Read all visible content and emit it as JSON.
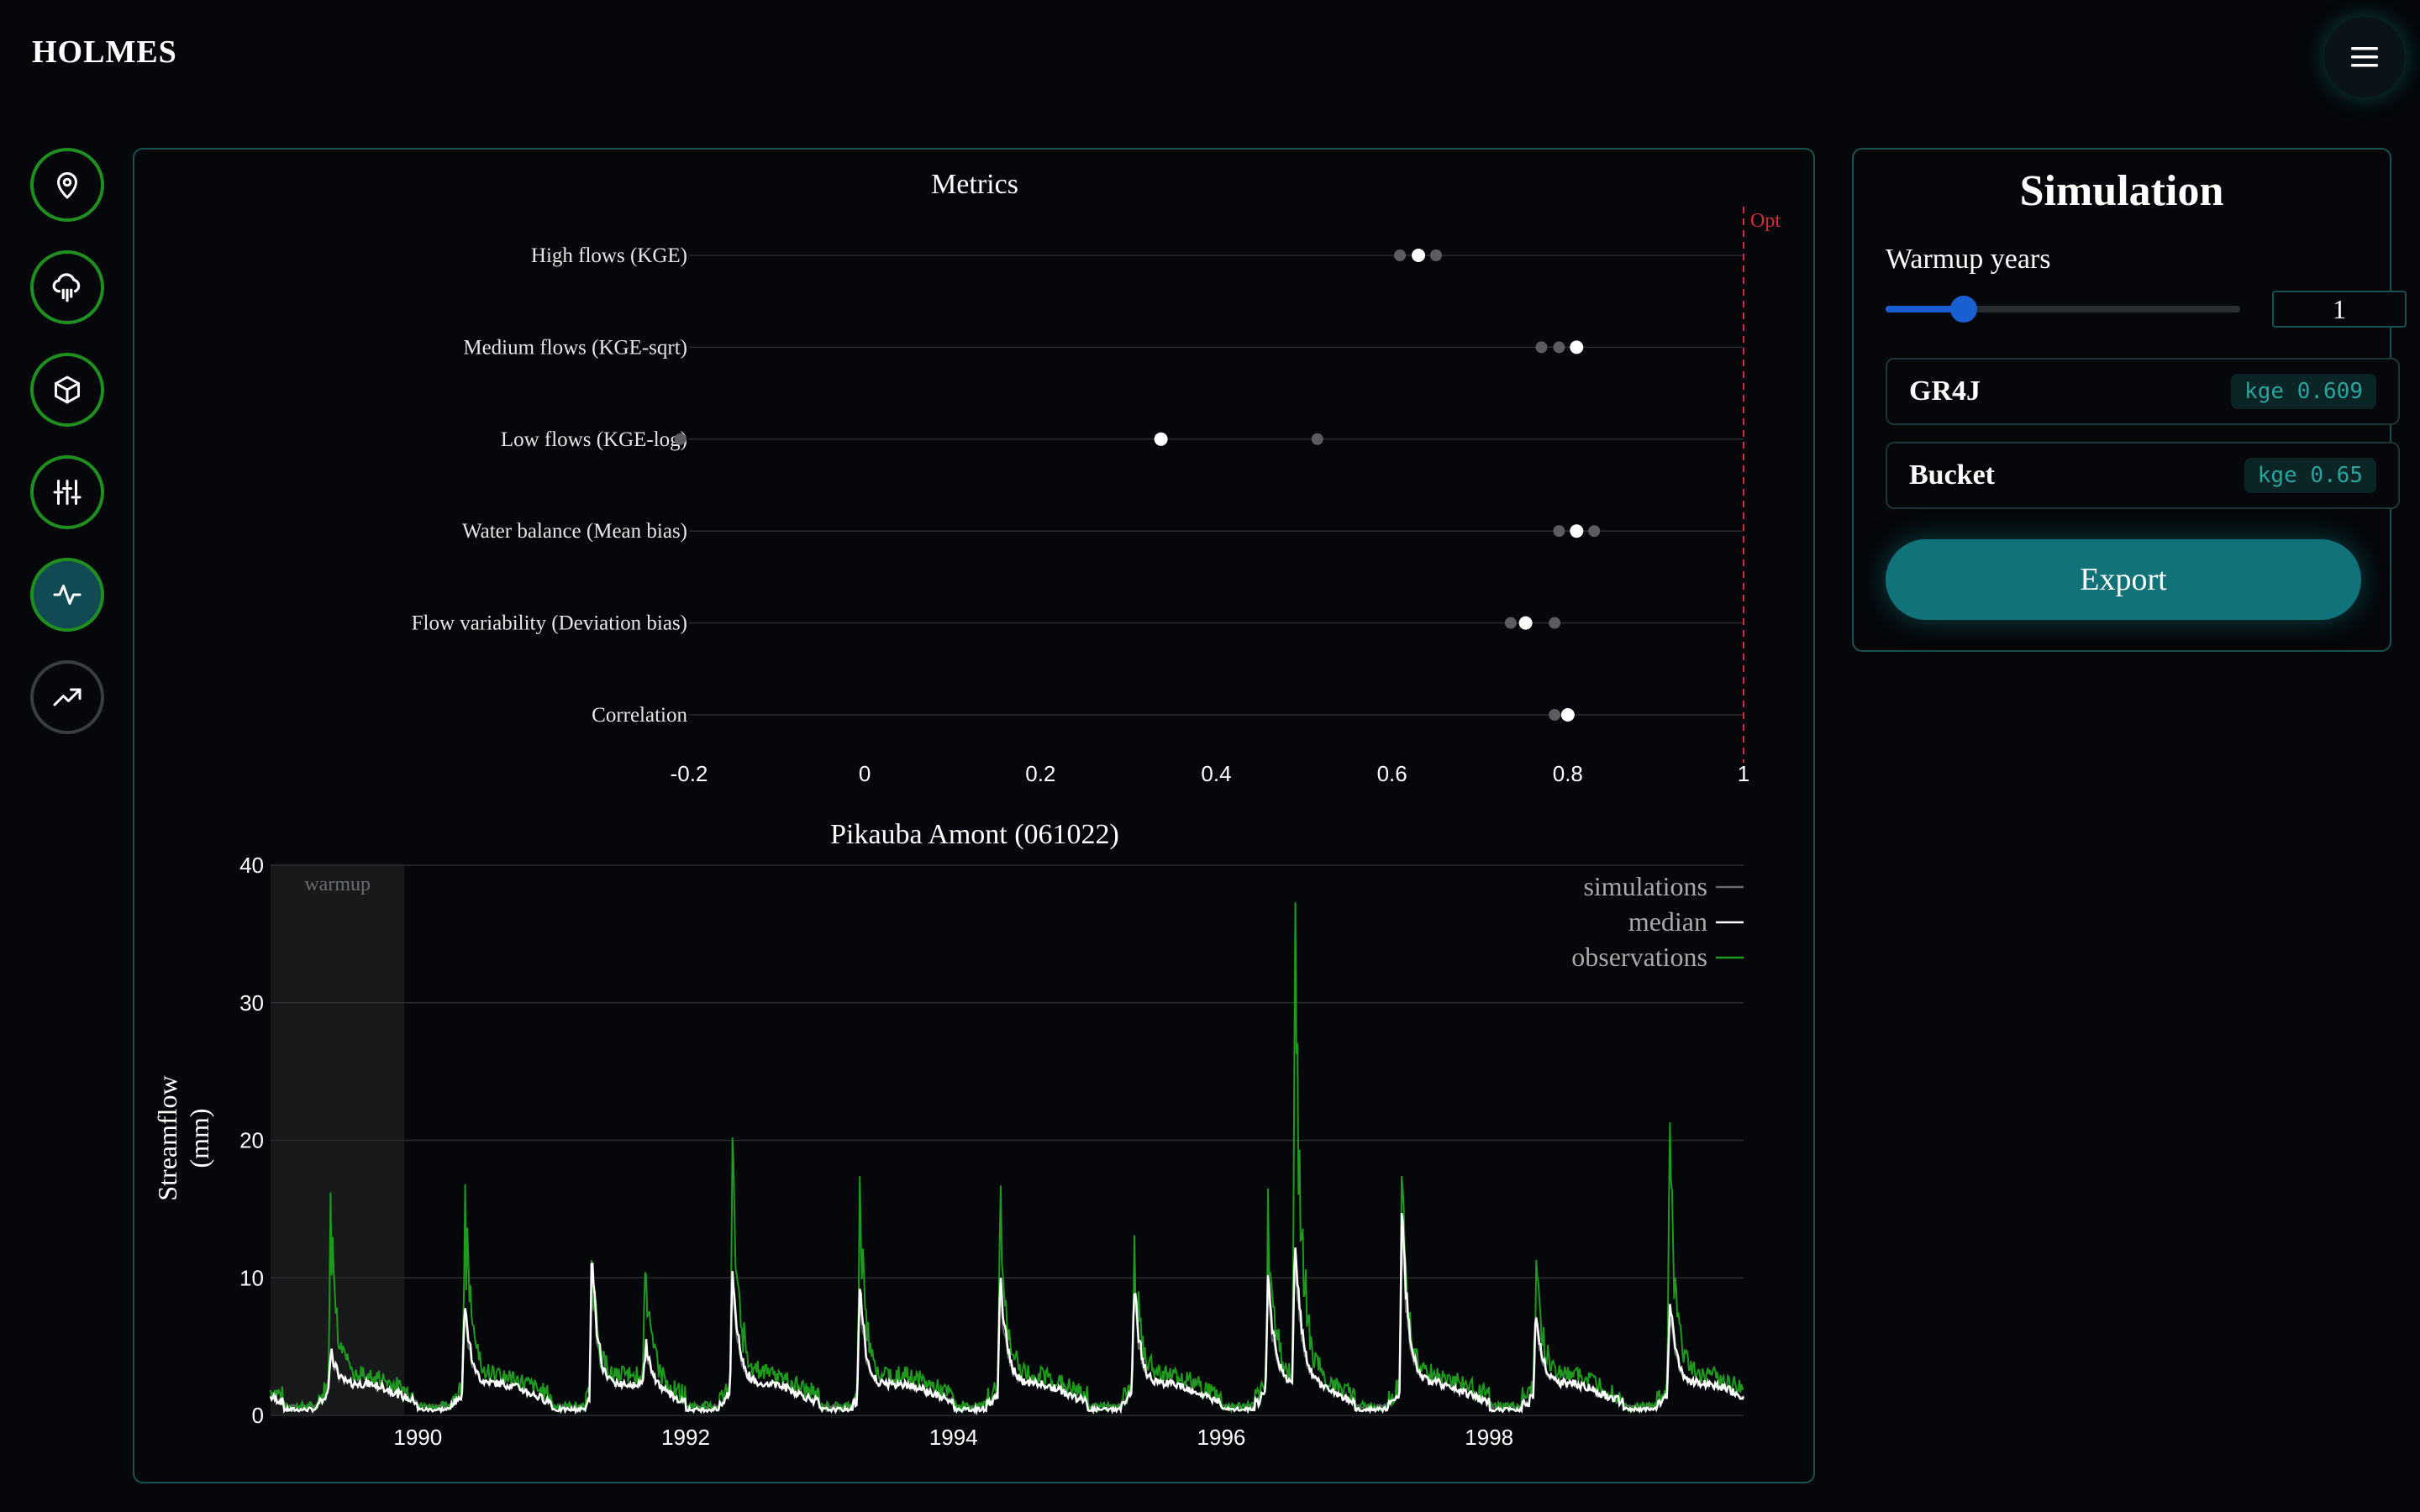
{
  "app": {
    "title": "HOLMES"
  },
  "header": {
    "menu_icon": "hamburger-menu-icon"
  },
  "sidebar": {
    "items": [
      {
        "name": "location",
        "icon": "map-pin-icon",
        "state": "done"
      },
      {
        "name": "forcing",
        "icon": "rain-cloud-icon",
        "state": "done"
      },
      {
        "name": "model",
        "icon": "cube-icon",
        "state": "done"
      },
      {
        "name": "calibration",
        "icon": "sliders-icon",
        "state": "done"
      },
      {
        "name": "simulation",
        "icon": "activity-pulse-icon",
        "state": "active"
      },
      {
        "name": "projection",
        "icon": "trending-up-icon",
        "state": "disabled"
      }
    ]
  },
  "simulation": {
    "title": "Simulation",
    "warmup_label": "Warmup years",
    "warmup_value": "1",
    "warmup_fraction": 0.22,
    "models": [
      {
        "name": "GR4J",
        "badge": "kge 0.609"
      },
      {
        "name": "Bucket",
        "badge": "kge 0.65"
      }
    ],
    "export_label": "Export"
  },
  "colors": {
    "accent": "#11727a",
    "observations": "#1f9a1f",
    "median": "#ffffff",
    "simulations": "#666666",
    "optimum": "#d0303a",
    "slider": "#1a5fd1"
  },
  "chart_data": [
    {
      "type": "scatter",
      "title": "Metrics",
      "xlim": [
        -0.2,
        1
      ],
      "x_ticks": [
        "-0.2",
        "0",
        "0.2",
        "0.4",
        "0.6",
        "0.8",
        "1"
      ],
      "x_tick_values": [
        -0.2,
        0,
        0.2,
        0.4,
        0.6,
        0.8,
        1
      ],
      "optimum_label": "Opt",
      "optimum_value": 1,
      "grid": true,
      "rows": [
        {
          "label": "High flows (KGE)",
          "simulations": [
            0.609,
            0.65
          ],
          "median": 0.63
        },
        {
          "label": "Medium flows (KGE-sqrt)",
          "simulations": [
            0.77,
            0.79
          ],
          "median": 0.81
        },
        {
          "label": "Low flows (KGE-log)",
          "simulations": [
            -0.21,
            0.515
          ],
          "median": 0.337
        },
        {
          "label": "Water balance (Mean bias)",
          "simulations": [
            0.79,
            0.83
          ],
          "median": 0.81
        },
        {
          "label": "Flow variability (Deviation bias)",
          "simulations": [
            0.735,
            0.785
          ],
          "median": 0.752
        },
        {
          "label": "Correlation",
          "simulations": [
            0.785
          ],
          "median": 0.8
        }
      ]
    },
    {
      "type": "line",
      "title": "Pikauba Amont (061022)",
      "ylabel": "Streamflow (mm)",
      "ylim": [
        0,
        40
      ],
      "y_ticks": [
        "0",
        "10",
        "20",
        "30",
        "40"
      ],
      "y_tick_values": [
        0,
        10,
        20,
        30,
        40
      ],
      "xlim": [
        1988.9,
        1999.9
      ],
      "x_ticks": [
        "1990",
        "1992",
        "1994",
        "1996",
        "1998"
      ],
      "x_tick_values": [
        1990,
        1992,
        1994,
        1996,
        1998
      ],
      "warmup_label": "warmup",
      "warmup_range": [
        1988.9,
        1989.9
      ],
      "grid": true,
      "legend_position": "top-right",
      "legend": [
        "simulations",
        "median",
        "observations"
      ],
      "peaks": [
        {
          "x": 1989.35,
          "obs": 16.2,
          "median": 4.2
        },
        {
          "x": 1990.35,
          "obs": 16.8,
          "median": 7.8
        },
        {
          "x": 1991.3,
          "obs": 11.3,
          "median": 11.0
        },
        {
          "x": 1991.7,
          "obs": 10.4,
          "median": 4.0
        },
        {
          "x": 1992.35,
          "obs": 20.2,
          "median": 10.5
        },
        {
          "x": 1993.3,
          "obs": 17.4,
          "median": 9.2
        },
        {
          "x": 1994.35,
          "obs": 16.7,
          "median": 10.0
        },
        {
          "x": 1995.35,
          "obs": 13.1,
          "median": 8.8
        },
        {
          "x": 1996.35,
          "obs": 16.5,
          "median": 10.2
        },
        {
          "x": 1996.55,
          "obs": 37.3,
          "median": 12.2
        },
        {
          "x": 1997.35,
          "obs": 17.4,
          "median": 14.7
        },
        {
          "x": 1998.35,
          "obs": 11.3,
          "median": 7.1
        },
        {
          "x": 1999.35,
          "obs": 21.3,
          "median": 8.1
        }
      ]
    }
  ]
}
